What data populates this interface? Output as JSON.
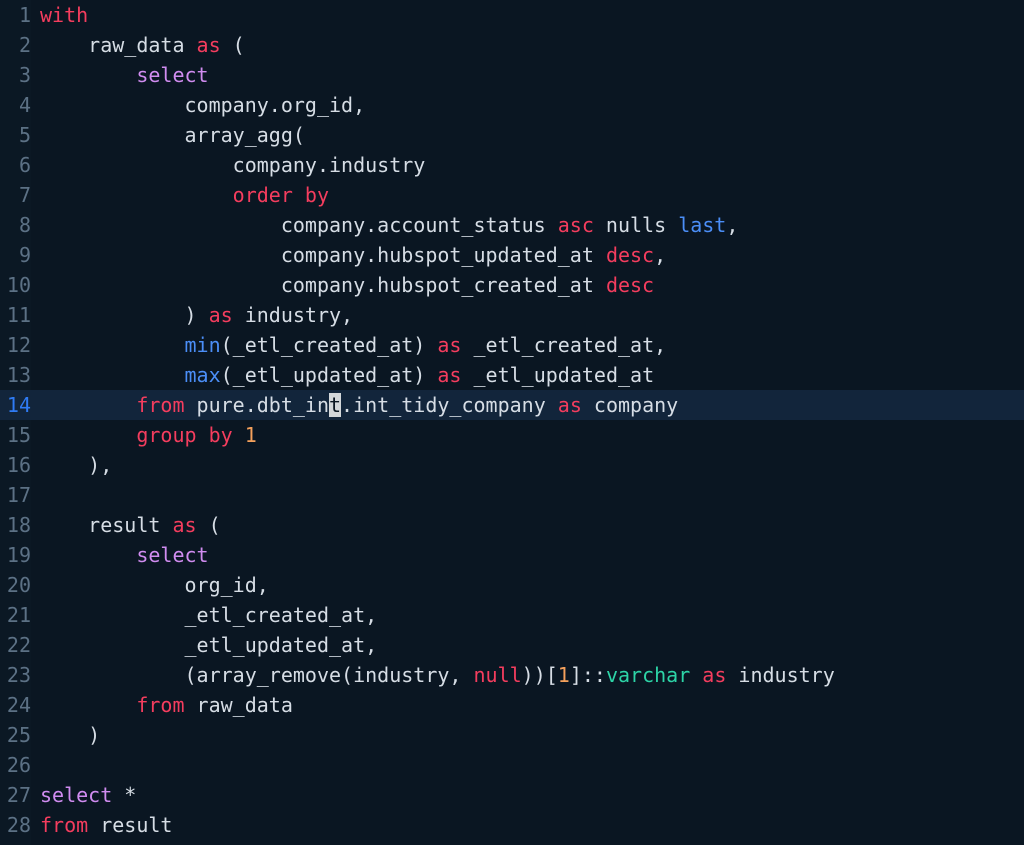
{
  "editor": {
    "language": "sql",
    "background_color": "#0a1622",
    "gutter_color": "#0b1824",
    "active_line_color": "#12253b",
    "active_line_number": 14,
    "cursor": {
      "line": 14,
      "column": 23,
      "char": "t",
      "color": "#d3d7da"
    },
    "colors": {
      "keyword": "#f43d5e",
      "select": "#d08cf0",
      "function": "#4b8ef7",
      "number": "#f5a15c",
      "type": "#2dd4a7",
      "text": "#d6dde5",
      "line_number": "#5c7185",
      "active_line_number": "#2f7bf4"
    },
    "lines": [
      {
        "n": "1",
        "tokens": [
          {
            "t": "with",
            "c": "kw"
          }
        ]
      },
      {
        "n": "2",
        "tokens": [
          {
            "t": "    raw_data ",
            "c": "plain"
          },
          {
            "t": "as",
            "c": "kw"
          },
          {
            "t": " (",
            "c": "plain"
          }
        ]
      },
      {
        "n": "3",
        "tokens": [
          {
            "t": "        ",
            "c": "plain"
          },
          {
            "t": "select",
            "c": "select"
          }
        ]
      },
      {
        "n": "4",
        "tokens": [
          {
            "t": "            company.org_id,",
            "c": "plain"
          }
        ]
      },
      {
        "n": "5",
        "tokens": [
          {
            "t": "            array_agg(",
            "c": "plain"
          }
        ]
      },
      {
        "n": "6",
        "tokens": [
          {
            "t": "                company.industry",
            "c": "plain"
          }
        ]
      },
      {
        "n": "7",
        "tokens": [
          {
            "t": "                ",
            "c": "plain"
          },
          {
            "t": "order by",
            "c": "kw"
          }
        ]
      },
      {
        "n": "8",
        "tokens": [
          {
            "t": "                    company.account_status ",
            "c": "plain"
          },
          {
            "t": "asc",
            "c": "kw"
          },
          {
            "t": " nulls ",
            "c": "plain"
          },
          {
            "t": "last",
            "c": "fn"
          },
          {
            "t": ",",
            "c": "plain"
          }
        ]
      },
      {
        "n": "9",
        "tokens": [
          {
            "t": "                    company.hubspot_updated_at ",
            "c": "plain"
          },
          {
            "t": "desc",
            "c": "kw"
          },
          {
            "t": ",",
            "c": "plain"
          }
        ]
      },
      {
        "n": "10",
        "tokens": [
          {
            "t": "                    company.hubspot_created_at ",
            "c": "plain"
          },
          {
            "t": "desc",
            "c": "kw"
          }
        ]
      },
      {
        "n": "11",
        "tokens": [
          {
            "t": "            ) ",
            "c": "plain"
          },
          {
            "t": "as",
            "c": "kw"
          },
          {
            "t": " industry,",
            "c": "plain"
          }
        ]
      },
      {
        "n": "12",
        "tokens": [
          {
            "t": "            ",
            "c": "plain"
          },
          {
            "t": "min",
            "c": "fn"
          },
          {
            "t": "(_etl_created_at) ",
            "c": "plain"
          },
          {
            "t": "as",
            "c": "kw"
          },
          {
            "t": " _etl_created_at,",
            "c": "plain"
          }
        ]
      },
      {
        "n": "13",
        "tokens": [
          {
            "t": "            ",
            "c": "plain"
          },
          {
            "t": "max",
            "c": "fn"
          },
          {
            "t": "(_etl_updated_at) ",
            "c": "plain"
          },
          {
            "t": "as",
            "c": "kw"
          },
          {
            "t": " _etl_updated_at",
            "c": "plain"
          }
        ]
      },
      {
        "n": "14",
        "active": true,
        "tokens": [
          {
            "t": "        ",
            "c": "plain"
          },
          {
            "t": "from",
            "c": "kw"
          },
          {
            "t": " pure.dbt_in",
            "c": "plain"
          },
          {
            "t": "t",
            "c": "plain",
            "cursor": true
          },
          {
            "t": ".int_tidy_company ",
            "c": "plain"
          },
          {
            "t": "as",
            "c": "kw"
          },
          {
            "t": " company",
            "c": "plain"
          }
        ]
      },
      {
        "n": "15",
        "tokens": [
          {
            "t": "        ",
            "c": "plain"
          },
          {
            "t": "group by",
            "c": "kw"
          },
          {
            "t": " ",
            "c": "plain"
          },
          {
            "t": "1",
            "c": "num"
          }
        ]
      },
      {
        "n": "16",
        "tokens": [
          {
            "t": "    ),",
            "c": "plain"
          }
        ]
      },
      {
        "n": "17",
        "tokens": [
          {
            "t": "",
            "c": "plain"
          }
        ]
      },
      {
        "n": "18",
        "tokens": [
          {
            "t": "    result ",
            "c": "plain"
          },
          {
            "t": "as",
            "c": "kw"
          },
          {
            "t": " (",
            "c": "plain"
          }
        ]
      },
      {
        "n": "19",
        "tokens": [
          {
            "t": "        ",
            "c": "plain"
          },
          {
            "t": "select",
            "c": "select"
          }
        ]
      },
      {
        "n": "20",
        "tokens": [
          {
            "t": "            org_id,",
            "c": "plain"
          }
        ]
      },
      {
        "n": "21",
        "tokens": [
          {
            "t": "            _etl_created_at,",
            "c": "plain"
          }
        ]
      },
      {
        "n": "22",
        "tokens": [
          {
            "t": "            _etl_updated_at,",
            "c": "plain"
          }
        ]
      },
      {
        "n": "23",
        "tokens": [
          {
            "t": "            (array_remove(industry, ",
            "c": "plain"
          },
          {
            "t": "null",
            "c": "kw"
          },
          {
            "t": "))[",
            "c": "plain"
          },
          {
            "t": "1",
            "c": "num"
          },
          {
            "t": "]::",
            "c": "plain"
          },
          {
            "t": "varchar",
            "c": "type"
          },
          {
            "t": " ",
            "c": "plain"
          },
          {
            "t": "as",
            "c": "kw"
          },
          {
            "t": " industry",
            "c": "plain"
          }
        ]
      },
      {
        "n": "24",
        "tokens": [
          {
            "t": "        ",
            "c": "plain"
          },
          {
            "t": "from",
            "c": "kw"
          },
          {
            "t": " raw_data",
            "c": "plain"
          }
        ]
      },
      {
        "n": "25",
        "tokens": [
          {
            "t": "    )",
            "c": "plain"
          }
        ]
      },
      {
        "n": "26",
        "tokens": [
          {
            "t": "",
            "c": "plain"
          }
        ]
      },
      {
        "n": "27",
        "tokens": [
          {
            "t": "select",
            "c": "select"
          },
          {
            "t": " *",
            "c": "plain"
          }
        ]
      },
      {
        "n": "28",
        "tokens": [
          {
            "t": "from",
            "c": "kw"
          },
          {
            "t": " result",
            "c": "plain"
          }
        ]
      }
    ],
    "full_text": "with\n    raw_data as (\n        select\n            company.org_id,\n            array_agg(\n                company.industry\n                order by\n                    company.account_status asc nulls last,\n                    company.hubspot_updated_at desc,\n                    company.hubspot_created_at desc\n            ) as industry,\n            min(_etl_created_at) as _etl_created_at,\n            max(_etl_updated_at) as _etl_updated_at\n        from pure.dbt_int.int_tidy_company as company\n        group by 1\n    ),\n\n    result as (\n        select\n            org_id,\n            _etl_created_at,\n            _etl_updated_at,\n            (array_remove(industry, null))[1]::varchar as industry\n        from raw_data\n    )\n\nselect *\nfrom result"
  }
}
